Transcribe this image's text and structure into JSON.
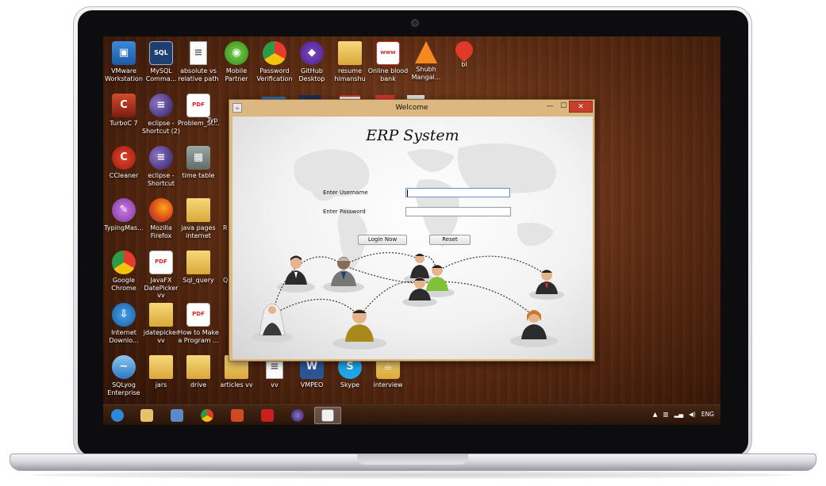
{
  "desktop": {
    "icons": [
      {
        "label": "VMware Workstation",
        "icon": "vmware-icon"
      },
      {
        "label": "MySQL Comma...",
        "icon": "mysql-icon"
      },
      {
        "label": "absolute vs relative path",
        "icon": "document-icon"
      },
      {
        "label": "Mobile Partner",
        "icon": "mobile-partner-icon"
      },
      {
        "label": "Password Verification",
        "icon": "chrome-icon"
      },
      {
        "label": "GitHub Desktop",
        "icon": "github-icon"
      },
      {
        "label": "resume himanshu",
        "icon": "folder-icon"
      },
      {
        "label": "Online blood bank",
        "icon": "web-page-icon"
      },
      {
        "label": "Shubh Mangal...",
        "icon": "vlc-icon"
      },
      {
        "label": "bl",
        "icon": "blood-drop-icon"
      },
      {
        "label": "TurboC 7",
        "icon": "turboc-icon"
      },
      {
        "label": "eclipse - Shortcut (2)",
        "icon": "eclipse-icon"
      },
      {
        "label": "Problem_St...",
        "icon": "pdf-icon"
      },
      {
        "label": "Typ",
        "icon": "partial-icon"
      },
      {
        "label": "CCleaner",
        "icon": "ccleaner-icon"
      },
      {
        "label": "eclipse - Shortcut",
        "icon": "eclipse-icon"
      },
      {
        "label": "time table",
        "icon": "image-icon"
      },
      {
        "label": "TypingMas...",
        "icon": "typingmaster-icon"
      },
      {
        "label": "Mozilla Firefox",
        "icon": "firefox-icon"
      },
      {
        "label": "java pages internet",
        "icon": "folder-icon"
      },
      {
        "label": "R",
        "icon": "partial-icon"
      },
      {
        "label": "Google Chrome",
        "icon": "chrome-icon"
      },
      {
        "label": "JavaFX DatePicker vv",
        "icon": "pdf-icon"
      },
      {
        "label": "Sql_query",
        "icon": "folder-icon"
      },
      {
        "label": "Q",
        "icon": "partial-icon"
      },
      {
        "label": "Internet Downlo...",
        "icon": "internet-download-icon"
      },
      {
        "label": "jdatepicker vv",
        "icon": "folder-icon"
      },
      {
        "label": "How to Make a Program ...",
        "icon": "pdf-icon"
      },
      {
        "label": "SQLyog Enterprise",
        "icon": "sqlyog-icon"
      },
      {
        "label": "jars",
        "icon": "folder-icon"
      },
      {
        "label": "drive",
        "icon": "folder-icon"
      },
      {
        "label": "articles vv",
        "icon": "folder-icon"
      },
      {
        "label": "vv",
        "icon": "document-icon"
      },
      {
        "label": "VMPEO",
        "icon": "word-icon"
      },
      {
        "label": "Skype",
        "icon": "skype-icon"
      },
      {
        "label": "interview",
        "icon": "jar-icon"
      }
    ]
  },
  "window": {
    "title": "Welcome",
    "min_label": "—",
    "max_label": "☐",
    "close_label": "✕",
    "heading": "ERP System",
    "username_label": "Enter Username",
    "password_label": "Enter Password",
    "username_value": "",
    "password_value": "",
    "login_button": "Login Now",
    "reset_button": "Reset"
  },
  "taskbar": {
    "language": "ENG",
    "tray_arrow": "▲",
    "tray_icons": [
      "network-icon",
      "signal-icon",
      "volume-icon"
    ]
  }
}
